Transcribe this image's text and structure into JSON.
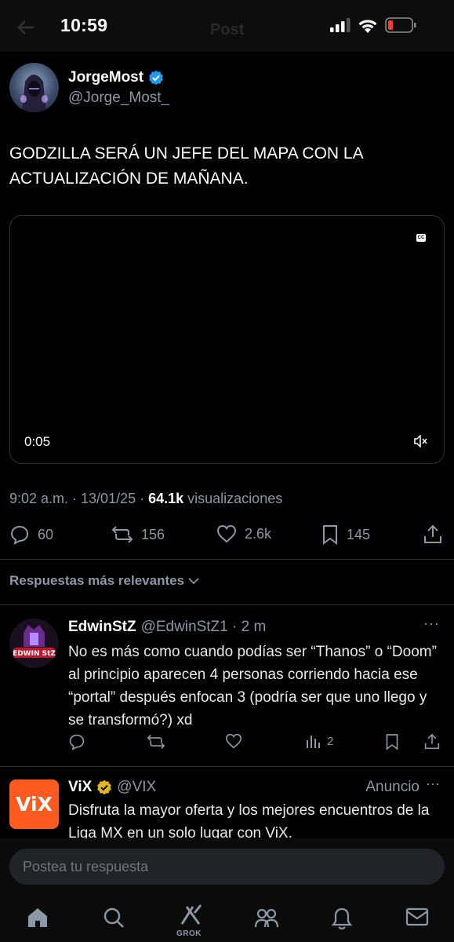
{
  "status_bar": {
    "time": "10:59",
    "ghost_title": "Post"
  },
  "post": {
    "author_name": "JorgeMost",
    "author_handle": "@Jorge_Most_",
    "text": "GODZILLA SERÁ UN JEFE DEL MAPA CON LA ACTUALIZACIÓN DE MAÑANA.",
    "video": {
      "elapsed": "0:05",
      "captions_label": "CC"
    },
    "timestamp": "9:02 a.m. · 13/01/25 · ",
    "views_count": "64.1k",
    "views_label": " visualizaciones",
    "stats": {
      "replies": "60",
      "reposts": "156",
      "likes": "2.6k",
      "bookmarks": "145"
    }
  },
  "replies_sort": "Respuestas más relevantes",
  "reply": {
    "author_name": "EdwinStZ",
    "handle_time": "@EdwinStZ1 · 2 m",
    "avatar_text": "EDWIN StZ",
    "text": "No es más como cuando podías ser “Thanos” o “Doom” al principio aparecen 4 personas corriendo hacia ese “portal” después enfocan 3 (podría ser que uno llego y se transformó?) xd",
    "views": "2",
    "more": "···"
  },
  "ad": {
    "author_name": "ViX",
    "handle": "@VIX",
    "label": "Anuncio",
    "logo": "ViX",
    "text": "Disfruta la mayor oferta y los mejores encuentros de la Liga MX en un solo lugar con ViX.",
    "more": "···"
  },
  "composer": {
    "placeholder": "Postea tu respuesta"
  },
  "tabbar": {
    "grok_label": "GROK"
  },
  "colors": {
    "background": "#000000",
    "text": "#e7e9ea",
    "muted": "#8b98a5",
    "verified": "#1d9bf0",
    "gold": "#e2b719"
  }
}
